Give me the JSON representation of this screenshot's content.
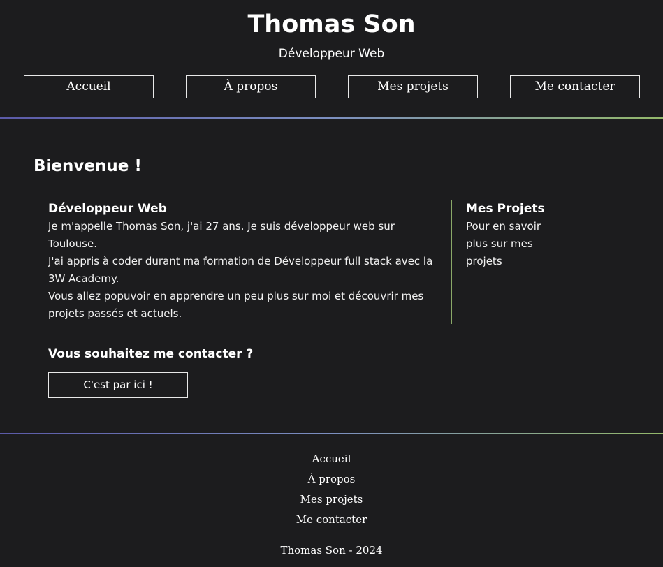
{
  "header": {
    "title": "Thomas Son",
    "subtitle": "Développeur Web",
    "nav": [
      "Accueil",
      "À propos",
      "Mes projets",
      "Me contacter"
    ]
  },
  "main": {
    "heading": "Bienvenue !",
    "intro_card": {
      "title": "Développeur Web",
      "paragraphs": [
        "Je m'appelle Thomas Son, j'ai 27 ans. Je suis développeur web sur Toulouse.",
        "J'ai appris à coder durant ma formation de Développeur full stack avec la 3W Academy.",
        "Vous allez popuvoir en apprendre un peu plus sur moi et découvrir mes projets passés et actuels."
      ]
    },
    "projects_card": {
      "title": "Mes Projets",
      "text": "Pour en savoir plus sur mes projets"
    },
    "contact_card": {
      "title": "Vous souhaitez me contacter ?",
      "button": "C'est par ici !"
    }
  },
  "footer": {
    "links": [
      "Accueil",
      "À propos",
      "Mes projets",
      "Me contacter"
    ],
    "copyright": "Thomas Son - 2024"
  },
  "colors": {
    "background": "#1c1c1e",
    "accent_green": "#8aa868",
    "accent_purple": "#5b5aa8"
  }
}
